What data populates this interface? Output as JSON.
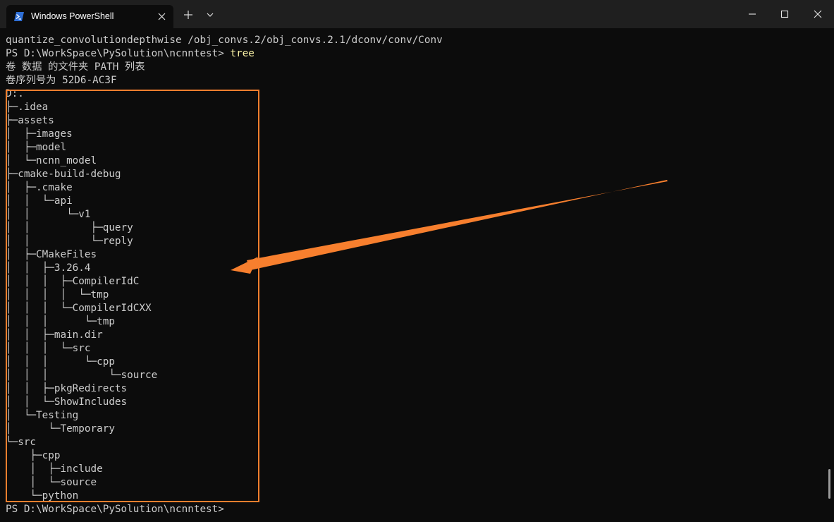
{
  "window": {
    "tab_title": "Windows PowerShell",
    "accent_color": "#f77f2e",
    "tab_icon": "powershell-icon"
  },
  "terminal": {
    "lines": [
      "quantize_convolutiondepthwise /obj_convs.2/obj_convs.2.1/dconv/conv/Conv",
      "卷 数据 的文件夹 PATH 列表",
      "卷序列号为 52D6-AC3F",
      "D:.",
      "├─.idea",
      "├─assets",
      "│  ├─images",
      "│  ├─model",
      "│  └─ncnn_model",
      "├─cmake-build-debug",
      "│  ├─.cmake",
      "│  │  └─api",
      "│  │      └─v1",
      "│  │          ├─query",
      "│  │          └─reply",
      "│  ├─CMakeFiles",
      "│  │  ├─3.26.4",
      "│  │  │  ├─CompilerIdC",
      "│  │  │  │  └─tmp",
      "│  │  │  └─CompilerIdCXX",
      "│  │  │      └─tmp",
      "│  │  ├─main.dir",
      "│  │  │  └─src",
      "│  │  │      └─cpp",
      "│  │  │          └─source",
      "│  │  ├─pkgRedirects",
      "│  │  └─ShowIncludes",
      "│  └─Testing",
      "│      └─Temporary",
      "└─src",
      "    ├─cpp",
      "    │  ├─include",
      "    │  └─source",
      "    └─python"
    ],
    "prompt": "PS D:\\WorkSpace\\PySolution\\ncnntest>",
    "command": "tree",
    "final_prompt": "PS D:\\WorkSpace\\PySolution\\ncnntest>"
  }
}
